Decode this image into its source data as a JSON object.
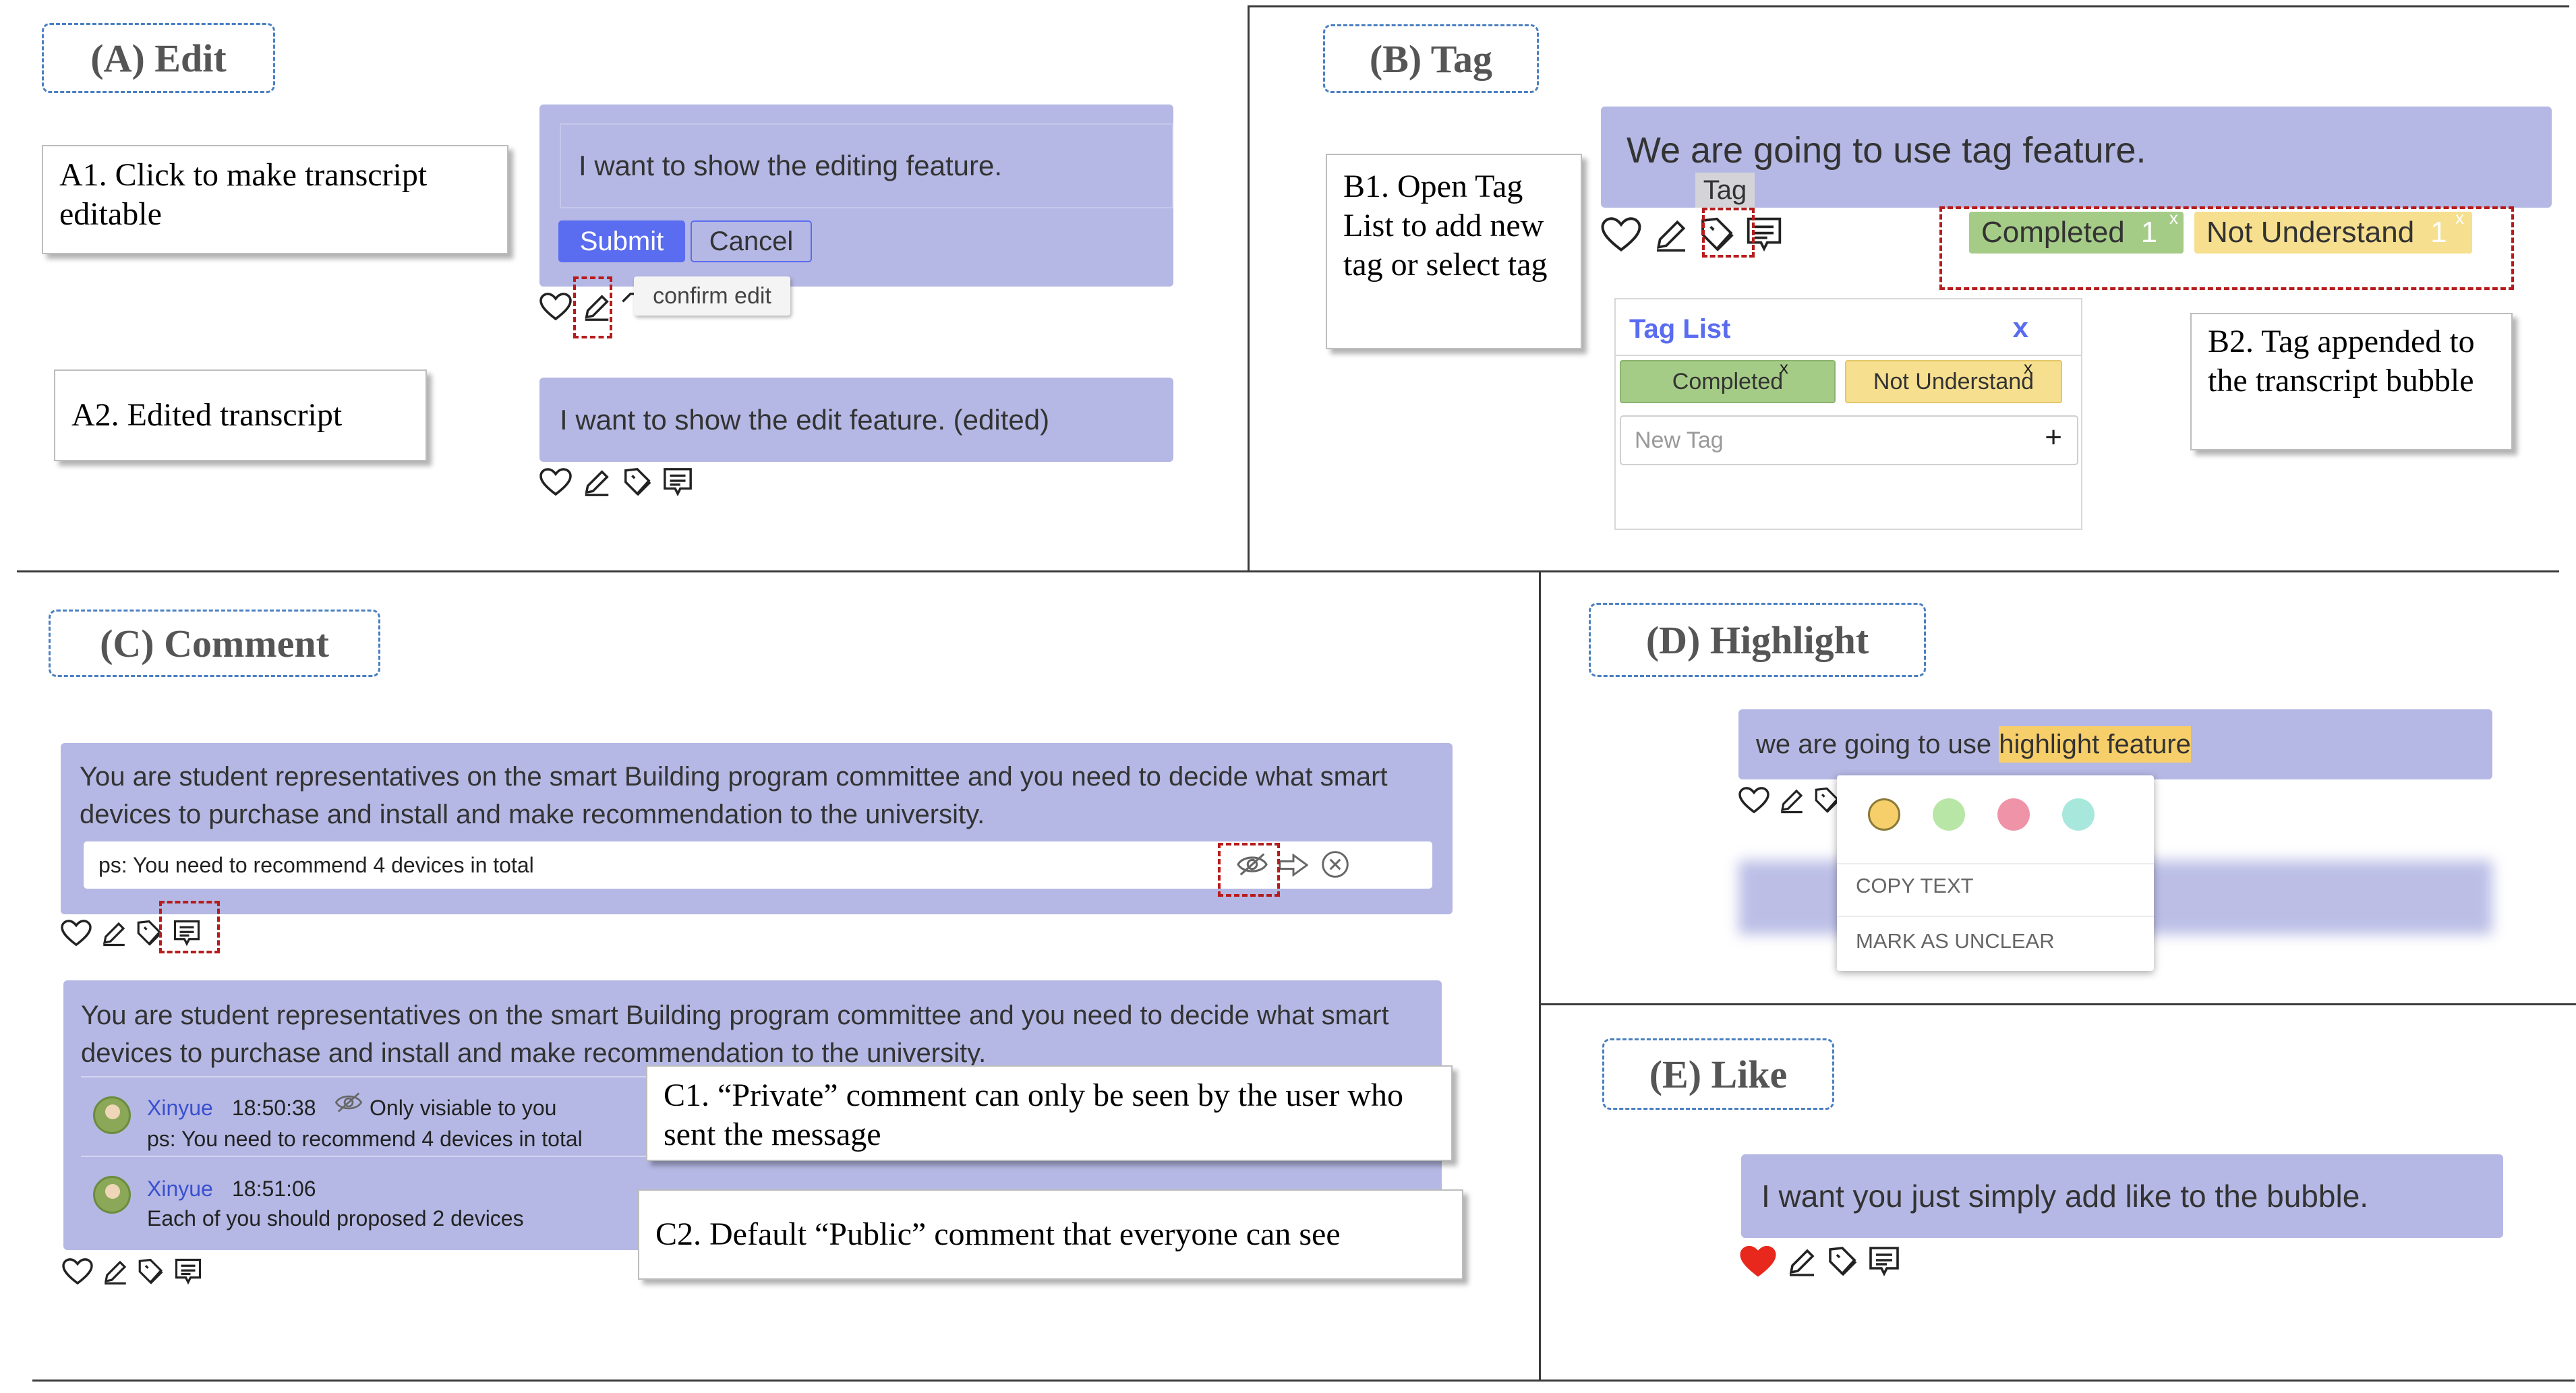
{
  "panels": {
    "edit": {
      "label": "(A) Edit",
      "note_a1": "A1. Click to make transcript editable",
      "note_a2": "A2. Edited transcript",
      "input_value": "I want to show the editing feature.",
      "submit_label": "Submit",
      "cancel_label": "Cancel",
      "tooltip": "confirm edit",
      "edited_text": "I want to show the edit feature. (edited)"
    },
    "tag": {
      "label": "(B) Tag",
      "bubble_text": "We are going to use tag feature.",
      "tooltip": "Tag",
      "note_b1": "B1. Open Tag List to add new tag or select tag",
      "note_b2": "B2. Tag appended to the transcript bubble",
      "applied_tags": [
        {
          "label": "Completed",
          "count": "1",
          "x": "x"
        },
        {
          "label": "Not Understand",
          "count": "1",
          "x": "x"
        }
      ],
      "tag_list_title": "Tag List",
      "tag_list_close": "x",
      "tag_list_items": [
        {
          "label": "Completed",
          "x": "x"
        },
        {
          "label": "Not Understand",
          "x": "x"
        }
      ],
      "new_tag_placeholder": "New Tag",
      "add_symbol": "+"
    },
    "comment": {
      "label": "(C) Comment",
      "bubble_text": "You are student representatives on the smart Building program committee and you need to decide what smart devices to purchase and install and make recommendation to the university.",
      "comment_input_value": "ps: You need to recommend 4 devices in total",
      "bubble2_text": "You are student representatives on the smart Building program committee and you need to decide what smart devices to purchase and install and make recommendation to the university.",
      "comments": [
        {
          "user": "Xinyue",
          "time": "18:50:38",
          "visibility": "Only visiable to you",
          "text": "ps: You need to recommend 4 devices in total"
        },
        {
          "user": "Xinyue",
          "time": "18:51:06",
          "visibility": "",
          "text": "Each of you should proposed 2 devices"
        }
      ],
      "note_c1": "C1. “Private” comment can only be seen by the user who sent the message",
      "note_c2": "C2. Default “Public” comment that everyone can see"
    },
    "highlight": {
      "label": "(D) Highlight",
      "text_plain": "we are going to use ",
      "text_highlight": "highlight feature",
      "menu_copy": "COPY TEXT",
      "menu_unclear": "MARK AS UNCLEAR",
      "colors": [
        "#f7cf6a",
        "#b8e6a6",
        "#ef93a8",
        "#a8e8dc"
      ]
    },
    "like": {
      "label": "(E) Like",
      "bubble_text": "I want you just simply add like to the bubble.",
      "liked": true
    }
  },
  "colors": {
    "bubble": "#b5b8e4",
    "accent_blue": "#5a6cf0",
    "red_dash": "#b71c1c",
    "label_border": "#4a7fc1",
    "like_red": "#e8271d",
    "tag_green": "#a5cc87",
    "tag_yellow": "#f6df8f"
  }
}
